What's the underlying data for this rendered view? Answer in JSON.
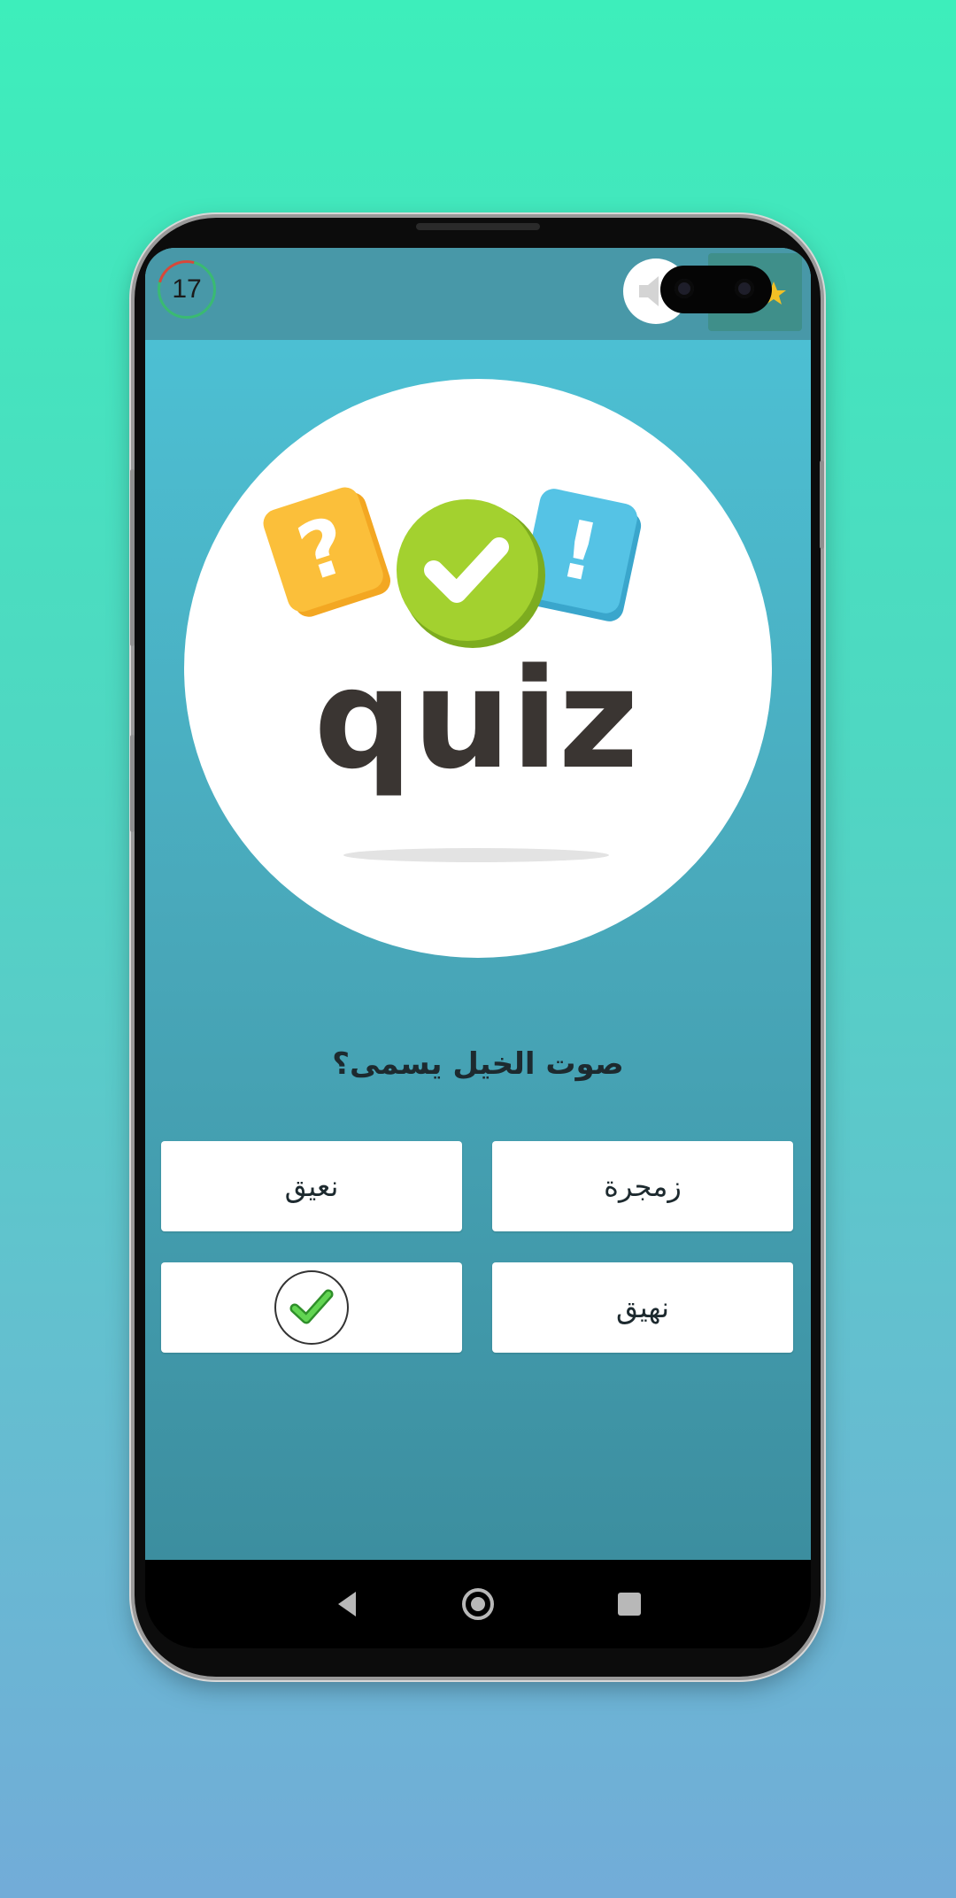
{
  "timer": {
    "seconds": "17"
  },
  "quiz": {
    "logo_word": "quiz",
    "question": "صوت الخيل يسمى؟",
    "answers": [
      {
        "label": "زمجرة"
      },
      {
        "label": "نعيق"
      },
      {
        "label": "نهيق"
      },
      {
        "label": ""
      }
    ]
  },
  "icons": {
    "timer": "countdown-ring",
    "sound": "speaker-icon",
    "coins": "star-icon",
    "correct": "checkmark-icon",
    "nav_back": "back-triangle-icon",
    "nav_home": "home-circle-icon",
    "nav_recents": "recents-square-icon"
  },
  "colors": {
    "background_top": "#3deebb",
    "background_bottom": "#72acd8",
    "topbar": "#4898a8",
    "timer_ring": "#3aba72",
    "correct_green": "#3dbb38"
  }
}
